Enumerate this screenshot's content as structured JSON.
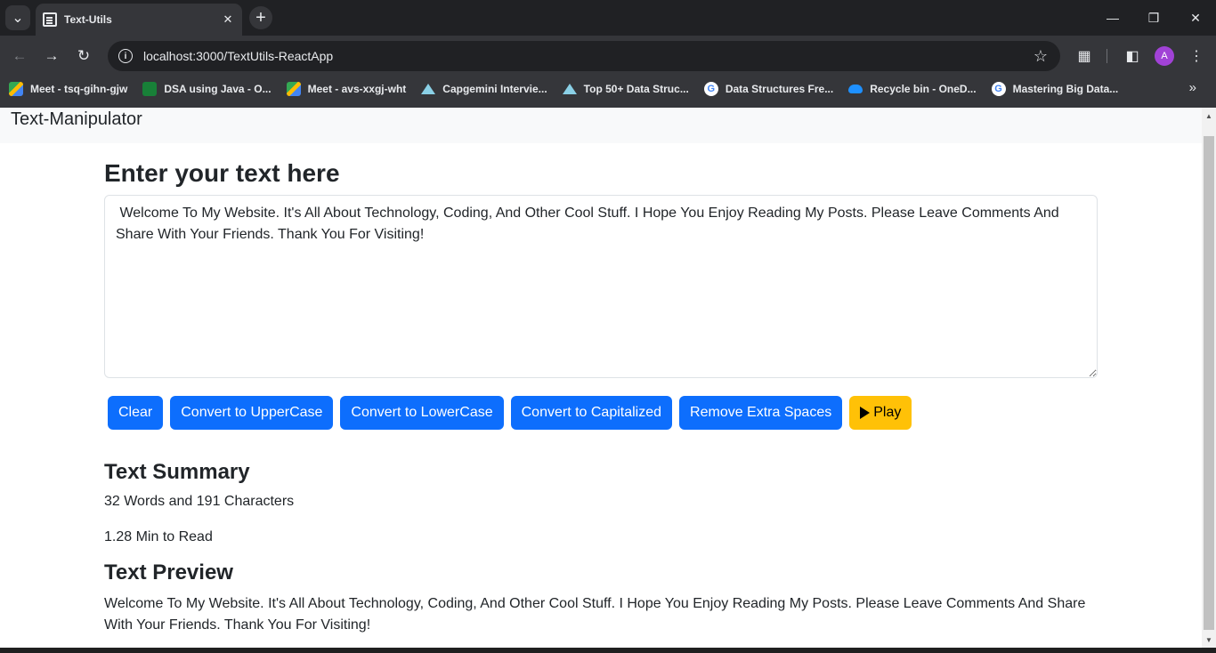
{
  "browser": {
    "tab_title": "Text-Utils",
    "url": "localhost:3000/TextUtils-ReactApp",
    "profile_initial": "A",
    "bookmarks": [
      {
        "label": "Meet - tsq-gihn-gjw",
        "icon": "meet-icon"
      },
      {
        "label": "DSA using Java - O...",
        "icon": "dsa-icon"
      },
      {
        "label": "Meet - avs-xxgj-wht",
        "icon": "meet-icon"
      },
      {
        "label": "Capgemini Intervie...",
        "icon": "triangle-icon"
      },
      {
        "label": "Top 50+ Data Struc...",
        "icon": "triangle-icon"
      },
      {
        "label": "Data Structures Fre...",
        "icon": "google-icon"
      },
      {
        "label": "Recycle bin - OneD...",
        "icon": "onedrive-icon"
      },
      {
        "label": "Mastering Big Data...",
        "icon": "google-icon"
      }
    ]
  },
  "navbar": {
    "brand": "Text-Manipulator"
  },
  "form": {
    "heading": "Enter your text here",
    "text": " Welcome To My Website. It's All About Technology, Coding, And Other Cool Stuff. I Hope You Enjoy Reading My Posts. Please Leave Comments And Share With Your Friends. Thank You For Visiting!"
  },
  "buttons": {
    "clear": "Clear",
    "upper": "Convert to UpperCase",
    "lower": "Convert to LowerCase",
    "capitalized": "Convert to Capitalized",
    "spaces": "Remove Extra Spaces",
    "play": "Play"
  },
  "summary": {
    "heading": "Text Summary",
    "words_chars": "32 Words and 191 Characters",
    "read_time": "1.28 Min to Read"
  },
  "preview": {
    "heading": "Text Preview",
    "text": "Welcome To My Website. It's All About Technology, Coding, And Other Cool Stuff. I Hope You Enjoy Reading My Posts. Please Leave Comments And Share With Your Friends. Thank You For Visiting!"
  },
  "colors": {
    "primary": "#0d6efd",
    "warning": "#ffc107",
    "navbar_bg": "#f8f9fa",
    "chrome_dark": "#202124",
    "chrome_toolbar": "#35363a"
  }
}
